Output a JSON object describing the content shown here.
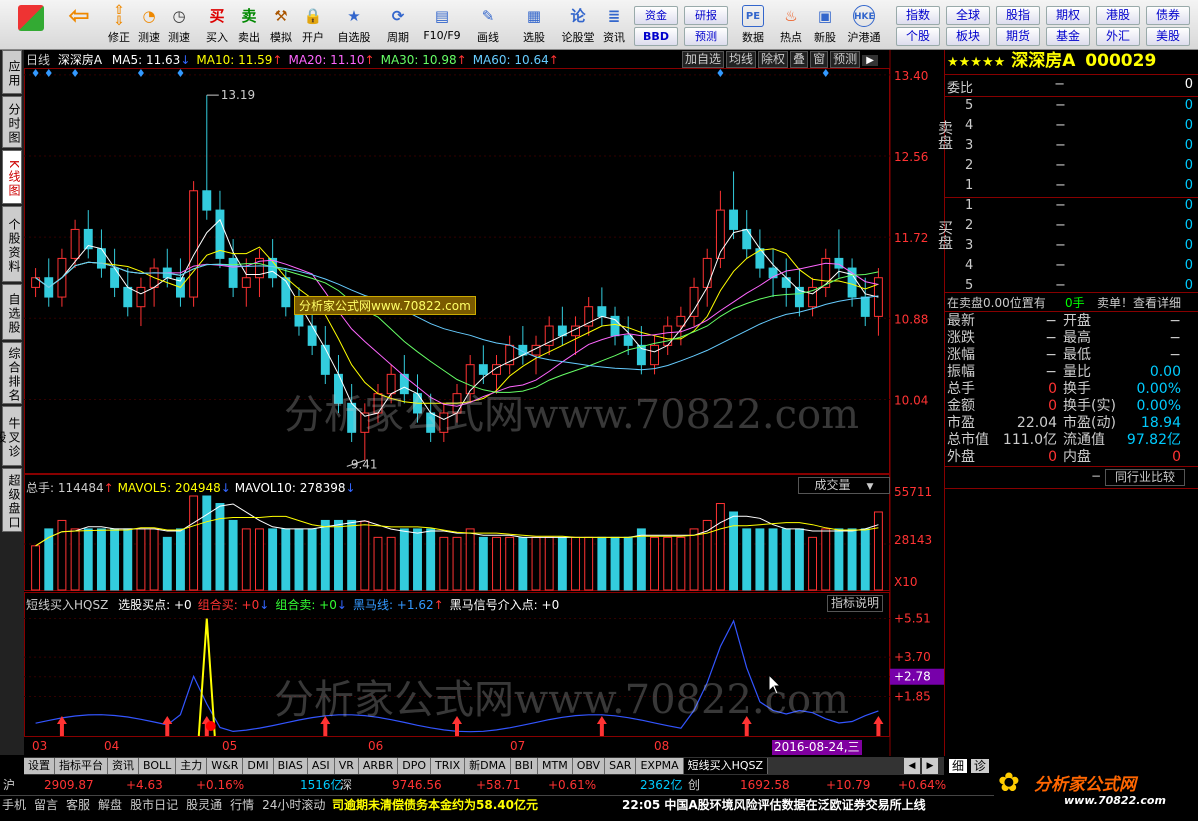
{
  "toolbar": {
    "items": [
      {
        "label": "",
        "icon": "grid-icon"
      },
      {
        "label": "",
        "icon": "back-icon"
      },
      {
        "label": "修正",
        "icon": "up-down-icon"
      },
      {
        "label": "测速",
        "icon": "speed-icon"
      },
      {
        "label": "测速",
        "icon": "clock-icon"
      },
      {
        "label": "买入",
        "icon": "buy-icon"
      },
      {
        "label": "卖出",
        "icon": "sell-icon"
      },
      {
        "label": "模拟",
        "icon": "hammer-icon"
      },
      {
        "label": "开户",
        "icon": "lock-icon"
      },
      {
        "label": "自选股",
        "icon": "star-icon"
      },
      {
        "label": "周期",
        "icon": "cycle-icon"
      },
      {
        "label": "F10/F9",
        "icon": "doc-icon"
      },
      {
        "label": "画线",
        "icon": "pen-icon"
      },
      {
        "label": "选股",
        "icon": "select-icon"
      },
      {
        "label": "论股堂",
        "icon": "talk-icon"
      },
      {
        "label": "资讯",
        "icon": "news-icon"
      }
    ],
    "small_buttons": [
      [
        "资金",
        "BBD"
      ],
      [
        "研报",
        "预测"
      ]
    ],
    "right_items": [
      {
        "label": "数据",
        "icon": "pe-icon"
      },
      {
        "label": "热点",
        "icon": "fire-icon"
      },
      {
        "label": "新股",
        "icon": "newstock-icon"
      },
      {
        "label": "沪港通",
        "icon": "hk-icon"
      }
    ],
    "market_buttons": [
      [
        "指数",
        "全球",
        "股指",
        "期权",
        "港股",
        "债券"
      ],
      [
        "个股",
        "板块",
        "期货",
        "基金",
        "外汇",
        "美股"
      ]
    ]
  },
  "left_tabs": [
    "应用",
    "分时图",
    "K线图",
    "个股资料",
    "自选股",
    "综合排名",
    "牛叉诊股",
    "超级盘口"
  ],
  "chart": {
    "period": "日线",
    "name": "深深房A",
    "ma": [
      {
        "label": "MA5: 11.63",
        "color": "#ffffff"
      },
      {
        "label": "MA10: 11.59",
        "color": "#ffff00"
      },
      {
        "label": "MA20: 11.10",
        "color": "#ff66ff"
      },
      {
        "label": "MA30: 10.98",
        "color": "#66ff66"
      },
      {
        "label": "MA60: 10.64",
        "color": "#66ccff"
      }
    ],
    "top_buttons": [
      "加自选",
      "均线",
      "除权",
      "叠",
      "窗",
      "预测"
    ],
    "price_ticks": [
      "13.40",
      "12.56",
      "11.72",
      "10.88",
      "10.04"
    ],
    "high_label": "13.19",
    "low_label": "9.41",
    "watermark_small": "分析家公式网www.70822.com",
    "watermark_big": "分析家公式网www.70822.com",
    "volume": {
      "total": "总手: 114484",
      "mavol5": "MAVOL5: 204948",
      "mavol10": "MAVOL10: 278398",
      "selector": "成交量",
      "ticks": [
        "55711",
        "28143",
        "X10"
      ]
    },
    "indicator": {
      "name": "短线买入HQSZ",
      "items": [
        {
          "label": "选股买点: +0",
          "color": "#ffffff"
        },
        {
          "label": "组合买: +0",
          "color": "#ff3333"
        },
        {
          "label": "组合卖: +0",
          "color": "#33ff33"
        },
        {
          "label": "黑马线: +1.62",
          "color": "#3399ff"
        },
        {
          "label": "黑马信号介入点: +0",
          "color": "#ffffff"
        }
      ],
      "explain": "指标说明",
      "ticks": [
        "+5.51",
        "+3.70",
        "+2.78",
        "+1.85"
      ]
    },
    "date_labels": [
      "03",
      "04",
      "05",
      "06",
      "07",
      "08"
    ],
    "cursor_date": "2016-08-24,三"
  },
  "chart_data": {
    "type": "candlestick",
    "title": "深深房A 日线",
    "ylim": [
      9.41,
      13.4
    ],
    "high": 13.19,
    "low": 9.41,
    "ma": {
      "MA5": 11.63,
      "MA10": 11.59,
      "MA20": 11.1,
      "MA30": 10.98,
      "MA60": 10.64
    },
    "ohlc": [
      [
        11.2,
        11.4,
        11.1,
        11.3
      ],
      [
        11.3,
        11.5,
        11.0,
        11.1
      ],
      [
        11.1,
        11.6,
        11.0,
        11.5
      ],
      [
        11.5,
        11.9,
        11.4,
        11.8
      ],
      [
        11.8,
        12.0,
        11.5,
        11.6
      ],
      [
        11.6,
        11.8,
        11.3,
        11.4
      ],
      [
        11.4,
        11.6,
        11.1,
        11.2
      ],
      [
        11.2,
        11.4,
        10.9,
        11.0
      ],
      [
        11.0,
        11.3,
        10.8,
        11.2
      ],
      [
        11.2,
        11.5,
        11.0,
        11.4
      ],
      [
        11.4,
        11.6,
        11.2,
        11.3
      ],
      [
        11.3,
        11.5,
        11.0,
        11.1
      ],
      [
        11.1,
        12.3,
        11.0,
        12.2
      ],
      [
        12.2,
        13.19,
        11.9,
        12.0
      ],
      [
        12.0,
        12.2,
        11.4,
        11.5
      ],
      [
        11.5,
        11.7,
        11.1,
        11.2
      ],
      [
        11.2,
        11.5,
        11.0,
        11.3
      ],
      [
        11.3,
        11.6,
        11.1,
        11.5
      ],
      [
        11.5,
        11.7,
        11.2,
        11.3
      ],
      [
        11.3,
        11.4,
        10.9,
        11.0
      ],
      [
        11.0,
        11.2,
        10.7,
        10.8
      ],
      [
        10.8,
        11.0,
        10.5,
        10.6
      ],
      [
        10.6,
        10.8,
        10.2,
        10.3
      ],
      [
        10.3,
        10.5,
        9.9,
        10.0
      ],
      [
        10.0,
        10.2,
        9.6,
        9.7
      ],
      [
        9.7,
        10.0,
        9.41,
        9.9
      ],
      [
        9.9,
        10.2,
        9.8,
        10.1
      ],
      [
        10.1,
        10.4,
        10.0,
        10.3
      ],
      [
        10.3,
        10.5,
        10.0,
        10.1
      ],
      [
        10.1,
        10.3,
        9.8,
        9.9
      ],
      [
        9.9,
        10.1,
        9.6,
        9.7
      ],
      [
        9.7,
        10.0,
        9.6,
        9.9
      ],
      [
        9.9,
        10.2,
        9.8,
        10.1
      ],
      [
        10.1,
        10.5,
        10.0,
        10.4
      ],
      [
        10.4,
        10.6,
        10.2,
        10.3
      ],
      [
        10.3,
        10.5,
        10.1,
        10.4
      ],
      [
        10.4,
        10.7,
        10.3,
        10.6
      ],
      [
        10.6,
        10.8,
        10.4,
        10.5
      ],
      [
        10.5,
        10.7,
        10.3,
        10.6
      ],
      [
        10.6,
        10.9,
        10.5,
        10.8
      ],
      [
        10.8,
        11.0,
        10.6,
        10.7
      ],
      [
        10.7,
        10.9,
        10.5,
        10.8
      ],
      [
        10.8,
        11.1,
        10.7,
        11.0
      ],
      [
        11.0,
        11.2,
        10.8,
        10.9
      ],
      [
        10.9,
        11.0,
        10.6,
        10.7
      ],
      [
        10.7,
        10.9,
        10.5,
        10.6
      ],
      [
        10.6,
        10.8,
        10.3,
        10.4
      ],
      [
        10.4,
        10.7,
        10.3,
        10.6
      ],
      [
        10.6,
        10.9,
        10.5,
        10.8
      ],
      [
        10.8,
        11.0,
        10.6,
        10.9
      ],
      [
        10.9,
        11.3,
        10.8,
        11.2
      ],
      [
        11.2,
        11.6,
        11.0,
        11.5
      ],
      [
        11.5,
        12.2,
        11.4,
        12.0
      ],
      [
        12.0,
        12.4,
        11.7,
        11.8
      ],
      [
        11.8,
        12.0,
        11.5,
        11.6
      ],
      [
        11.6,
        11.8,
        11.3,
        11.4
      ],
      [
        11.4,
        11.6,
        11.1,
        11.3
      ],
      [
        11.3,
        11.5,
        11.0,
        11.2
      ],
      [
        11.2,
        11.4,
        10.9,
        11.0
      ],
      [
        11.0,
        11.3,
        10.9,
        11.2
      ],
      [
        11.2,
        11.6,
        11.1,
        11.5
      ],
      [
        11.5,
        11.8,
        11.3,
        11.4
      ],
      [
        11.4,
        11.5,
        11.0,
        11.1
      ],
      [
        11.1,
        11.3,
        10.8,
        10.9
      ],
      [
        10.9,
        11.4,
        10.7,
        11.3
      ]
    ],
    "volume_ticks": [
      55711,
      28143
    ],
    "indicator_ticks": [
      5.51,
      3.7,
      2.78,
      1.85
    ],
    "indicator_current": 1.62
  },
  "quote": {
    "title": "深深房A",
    "code": "000029",
    "rank_stars": "★★★★★",
    "weibi_label": "委比",
    "weibi_val": "−",
    "weibi_right": "0",
    "sell_label": "卖盘",
    "buy_label": "买盘",
    "sell": [
      [
        "5",
        "−",
        "0"
      ],
      [
        "4",
        "−",
        "0"
      ],
      [
        "3",
        "−",
        "0"
      ],
      [
        "2",
        "−",
        "0"
      ],
      [
        "1",
        "−",
        "0"
      ]
    ],
    "buy": [
      [
        "1",
        "−",
        "0"
      ],
      [
        "2",
        "−",
        "0"
      ],
      [
        "3",
        "−",
        "0"
      ],
      [
        "4",
        "−",
        "0"
      ],
      [
        "5",
        "−",
        "0"
      ]
    ],
    "sell_text": "在卖盘0.00位置有",
    "sell_qty": "0手",
    "sell_hint": "卖单！查看详细",
    "stats": [
      [
        "最新",
        "−",
        "开盘",
        "−"
      ],
      [
        "涨跌",
        "−",
        "最高",
        "−"
      ],
      [
        "涨幅",
        "−",
        "最低",
        "−"
      ],
      [
        "振幅",
        "−",
        "量比",
        "0.00"
      ],
      [
        "总手",
        "0",
        "换手",
        "0.00%"
      ],
      [
        "金额",
        "0",
        "换手(实)",
        "0.00%"
      ],
      [
        "市盈",
        "22.04",
        "市盈(动)",
        "18.94"
      ],
      [
        "总市值",
        "111.0亿",
        "流通值",
        "97.82亿"
      ],
      [
        "外盘",
        "0",
        "内盘",
        "0"
      ]
    ],
    "compare_dash": "−",
    "compare_label": "同行业比较",
    "bottom_tabs": [
      "细",
      "诊"
    ]
  },
  "bottom_tabs": [
    "设置",
    "指标平台",
    "资讯",
    "BOLL",
    "主力",
    "W&R",
    "DMI",
    "BIAS",
    "ASI",
    "VR",
    "ARBR",
    "DPO",
    "TRIX",
    "新DMA",
    "BBI",
    "MTM",
    "OBV",
    "SAR",
    "EXPMA",
    "短线买入HQSZ"
  ],
  "status": {
    "sh_label": "沪",
    "sh_idx": "2909.87",
    "sh_chg": "+4.63",
    "sh_pct": "+0.16%",
    "sh_amt": "1516亿",
    "sz_label": "深",
    "sz_idx": "9746.56",
    "sz_chg": "+58.71",
    "sz_pct": "+0.61%",
    "sz_amt": "2362亿",
    "cy_label": "创",
    "cy_idx": "1692.58",
    "cy_chg": "+10.79",
    "cy_pct": "+0.64%",
    "links": [
      "手机",
      "留言",
      "客服",
      "解盘",
      "股市日记",
      "股灵通",
      "行情",
      "24小时滚动"
    ],
    "news1": "司逾期未清偿债务本金约为58.40亿元",
    "news2": "22:05 中国A股环境风险评估数据在泛欧证券交易所上线",
    "brand": "分析家公式网",
    "brand_url": "www.70822.com"
  }
}
